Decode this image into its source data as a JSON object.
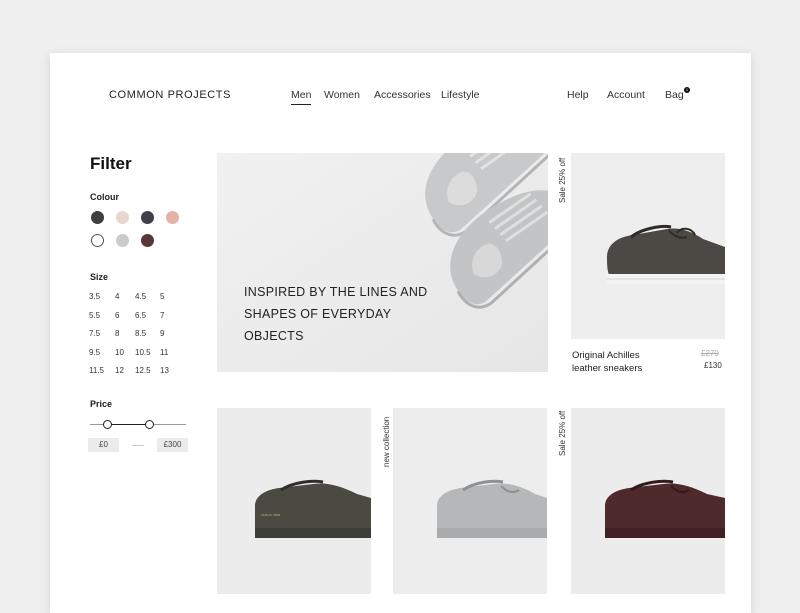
{
  "header": {
    "logo": "COMMON PROJECTS",
    "nav": [
      "Men",
      "Women",
      "Accessories",
      "Lifestyle"
    ],
    "active_nav": "Men",
    "utility": [
      "Help",
      "Account",
      "Bag"
    ],
    "bag_count": "1"
  },
  "filter": {
    "title": "Filter",
    "colour_label": "Colour",
    "colours": [
      "#3f3f41",
      "#e8d6cf",
      "#41404a",
      "#e3b3a8",
      "#ffffff",
      "#cbcbcb",
      "#5a3638"
    ],
    "size_label": "Size",
    "sizes": [
      "3.5",
      "4",
      "4.5",
      "5",
      "5.5",
      "6",
      "6.5",
      "7",
      "7.5",
      "8",
      "8.5",
      "9",
      "9.5",
      "10",
      "10.5",
      "11",
      "11.5",
      "12",
      "12.5",
      "13"
    ],
    "price_label": "Price",
    "price_min": "£0",
    "price_max": "£300"
  },
  "hero": {
    "text": "INSPIRED BY THE LINES AND SHAPES OF EVERYDAY OBJECTS"
  },
  "products": [
    {
      "badge": "Sale 25% off",
      "name": "Original Achilles leather sneakers",
      "old_price": "£270",
      "price": "£130"
    },
    {
      "badge": ""
    },
    {
      "badge": "new collection"
    },
    {
      "badge": "Sale 25% off"
    }
  ],
  "colors": {
    "page_bg": "#efefef",
    "card_bg": "#ffffff",
    "tile_bg": "#ededed",
    "shoe_grey_light": "#c9cacb",
    "shoe_dark_brown": "#4c4843",
    "shoe_olive": "#4a4a42",
    "shoe_grey": "#b5b7b9",
    "shoe_burgundy": "#4f2a2c"
  }
}
